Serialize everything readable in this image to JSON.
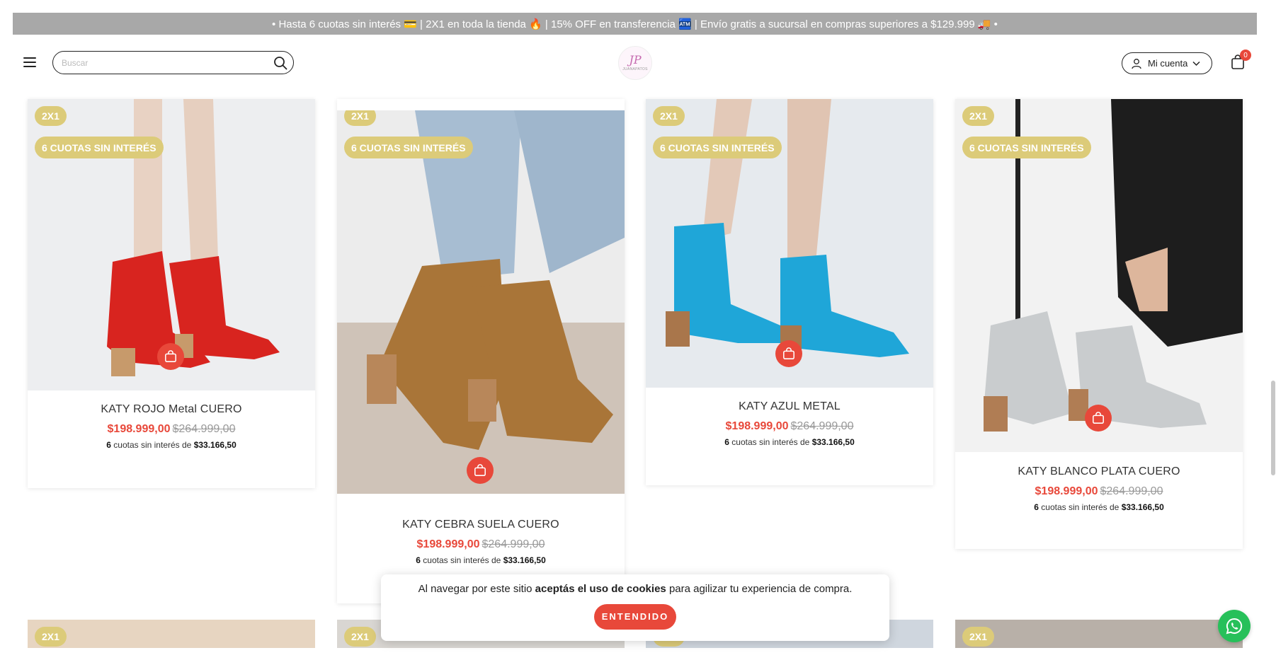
{
  "announcement": "• Hasta 6 cuotas sin interés 💳 | 2X1 en toda la tienda 🔥 | 15% OFF en transferencia 🏧 | Envío gratis a sucursal en compras superiores a $129.999 🚚 •",
  "header": {
    "search_placeholder": "Buscar",
    "logo_monogram": "JP",
    "logo_text": "JUANAPATOS",
    "account_label": "Mi cuenta",
    "cart_count": "0"
  },
  "colors": {
    "accent": "#e8483a",
    "badge": "#dccb79",
    "announcement_bg": "#a8a8a8",
    "whatsapp": "#27c05a"
  },
  "products": [
    {
      "badge_promo": "2X1",
      "badge_cuotas": "6 CUOTAS SIN INTERÉS",
      "name": "KATY ROJO Metal CUERO",
      "price": "$198.999,00",
      "old_price": "$264.999,00",
      "inst_count": "6",
      "inst_text": "cuotas sin interés de",
      "inst_amount": "$33.166,50",
      "boot_color": "#d8241f"
    },
    {
      "badge_promo": "2X1",
      "badge_cuotas": "6 CUOTAS SIN INTERÉS",
      "name": "KATY CEBRA SUELA CUERO",
      "price": "$198.999,00",
      "old_price": "$264.999,00",
      "inst_count": "6",
      "inst_text": "cuotas sin interés de",
      "inst_amount": "$33.166,50",
      "boot_color": "#a97538"
    },
    {
      "badge_promo": "2X1",
      "badge_cuotas": "6 CUOTAS SIN INTERÉS",
      "name": "KATY AZUL METAL",
      "price": "$198.999,00",
      "old_price": "$264.999,00",
      "inst_count": "6",
      "inst_text": "cuotas sin interés de",
      "inst_amount": "$33.166,50",
      "boot_color": "#1fa6d8"
    },
    {
      "badge_promo": "2X1",
      "badge_cuotas": "6 CUOTAS SIN INTERÉS",
      "name": "KATY BLANCO PLATA CUERO",
      "price": "$198.999,00",
      "old_price": "$264.999,00",
      "inst_count": "6",
      "inst_text": "cuotas sin interés de",
      "inst_amount": "$33.166,50",
      "boot_color": "#c9ccce"
    }
  ],
  "next_row_badges": [
    "2X1",
    "2X1",
    "2X1",
    "2X1"
  ],
  "cookie": {
    "text_before": "Al navegar por este sitio",
    "text_bold": "aceptás el uso de cookies",
    "text_after": "para agilizar tu experiencia de compra.",
    "button": "ENTENDIDO"
  }
}
